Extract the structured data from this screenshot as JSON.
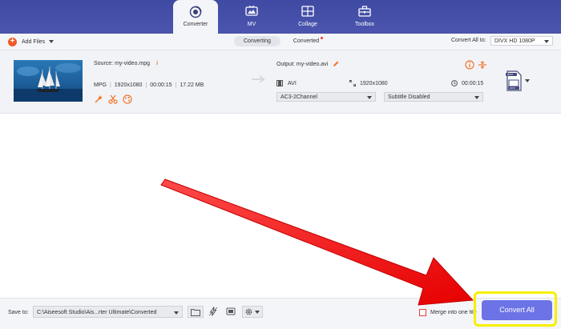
{
  "nav": {
    "tabs": [
      {
        "label": "Converter",
        "icon": "converter-icon",
        "active": true
      },
      {
        "label": "MV",
        "icon": "tv-icon",
        "active": false
      },
      {
        "label": "Collage",
        "icon": "collage-icon",
        "active": false
      },
      {
        "label": "Toolbox",
        "icon": "toolbox-icon",
        "active": false
      }
    ]
  },
  "toolbar": {
    "add_files_label": "Add Files",
    "subtabs": [
      {
        "label": "Converting",
        "active": true
      },
      {
        "label": "Converted",
        "active": false,
        "badge": true
      }
    ],
    "convert_all_to_label": "Convert All to:",
    "format_value": "DIVX HD 1080P"
  },
  "file": {
    "source_label": "Source: my-video.mpg",
    "format": "MPG",
    "resolution": "1920x1080",
    "duration": "00:00:15",
    "size": "17.22 MB",
    "output_label": "Output: my-video.avi",
    "out_format": "AVI",
    "out_resolution": "1920x1080",
    "out_duration": "00:00:15",
    "audio_track": "AC3-2Channel",
    "subtitle": "Subtitle Disabled",
    "format_badge_top": "DIVX",
    "format_badge_bottom": "DIVX"
  },
  "bottom": {
    "save_to_label": "Save to:",
    "save_path": "C:\\Aiseesoft Studio\\Ais...rter Ultimate\\Converted",
    "merge_label": "Merge into one file",
    "convert_all_button": "Convert All"
  },
  "colors": {
    "accent": "#6c73e6",
    "nav_bg": "#4a54a8",
    "highlight": "#f7ef00",
    "annotation_arrow": "#ff1a1a",
    "add_icon": "#f05a28"
  }
}
